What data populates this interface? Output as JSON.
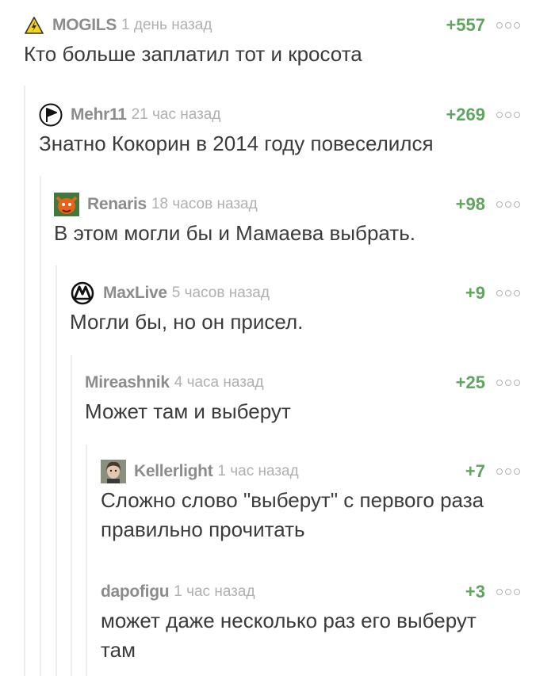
{
  "comments": [
    {
      "author": "MOGILS",
      "time": "1 день назад",
      "rating": "+557",
      "text": "Кто больше заплатил тот и кросота",
      "avatar_icon": "warning-triangle-icon"
    },
    {
      "author": "Mehr11",
      "time": "21 час назад",
      "rating": "+269",
      "text": "Знатно Кокорин в 2014 году повеселился",
      "avatar_icon": "pirate-party-icon"
    },
    {
      "author": "Renaris",
      "time": "18 часов назад",
      "rating": "+98",
      "text": "В этом могли бы и Мамаева выбрать.",
      "avatar_icon": "orange-creature-avatar"
    },
    {
      "author": "MaxLive",
      "time": "5 часов назад",
      "rating": "+9",
      "text": "Могли бы, но он присел.",
      "avatar_icon": "metro-m-logo-icon"
    },
    {
      "author": "Mireashnik",
      "time": "4 часа назад",
      "rating": "+25",
      "text": "Может там и выберут"
    },
    {
      "author": "Kellerlight",
      "time": "1 час назад",
      "rating": "+7",
      "text_lines": [
        "Сложно слово \"выберут\" с первого раза",
        "правильно прочитать"
      ],
      "avatar_icon": "portrait-avatar"
    },
    {
      "author": "dapofigu",
      "time": "1 час назад",
      "rating": "+3",
      "text_lines": [
        "может даже несколько раз его выберут",
        "там"
      ]
    }
  ],
  "colors": {
    "rating": "#5ea55e",
    "nick": "#8c8c8c",
    "time": "#b0b0b0",
    "text": "#3b3b3b"
  }
}
